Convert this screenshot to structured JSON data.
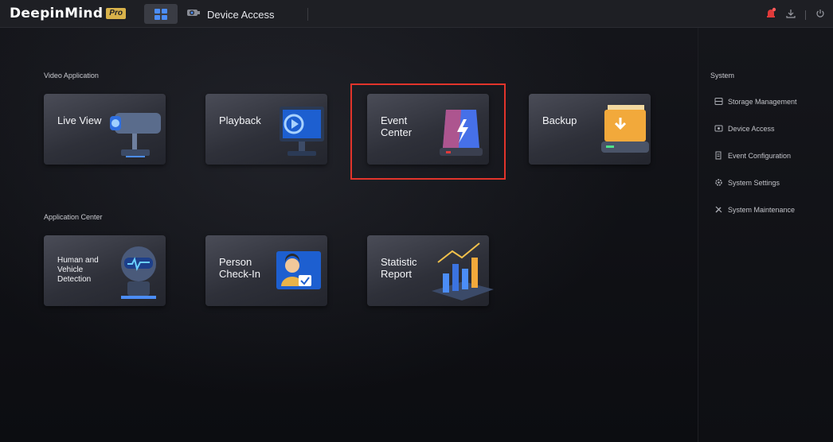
{
  "app": {
    "logo_text": "DeepinMind",
    "logo_badge": "Pro",
    "tabs": [
      {
        "label": "",
        "icon": "grid-icon",
        "active": true
      },
      {
        "label": "Device Access",
        "icon": "camera-icon",
        "active": false
      }
    ],
    "header_icons": [
      "alarm-icon",
      "download-icon",
      "power-icon"
    ]
  },
  "main": {
    "video_application": {
      "title": "Video Application",
      "cards": [
        {
          "label": "Live View",
          "icon": "camera-icon"
        },
        {
          "label": "Playback",
          "icon": "playback-icon"
        },
        {
          "label": "Event\nCenter",
          "icon": "alarm-light-icon",
          "highlighted": true
        },
        {
          "label": "Backup",
          "icon": "backup-folder-icon"
        }
      ]
    },
    "application_center": {
      "title": "Application Center",
      "cards": [
        {
          "label": "Human and\nVehicle\nDetection",
          "icon": "robot-icon"
        },
        {
          "label": "Person\nCheck-In",
          "icon": "person-checkin-icon"
        },
        {
          "label": "Statistic\nReport",
          "icon": "bar-chart-icon"
        }
      ]
    }
  },
  "sidebar": {
    "title": "System",
    "items": [
      {
        "label": "Storage Management",
        "icon": "storage-icon"
      },
      {
        "label": "Device Access",
        "icon": "device-icon"
      },
      {
        "label": "Event Configuration",
        "icon": "event-config-icon"
      },
      {
        "label": "System Settings",
        "icon": "gear-icon"
      },
      {
        "label": "System Maintenance",
        "icon": "wrench-icon"
      }
    ]
  },
  "colors": {
    "accent_blue": "#4b8df8",
    "highlight_red": "#e2342b",
    "alarm_red": "#e03a3a",
    "logo_badge": "#d8b24a"
  }
}
